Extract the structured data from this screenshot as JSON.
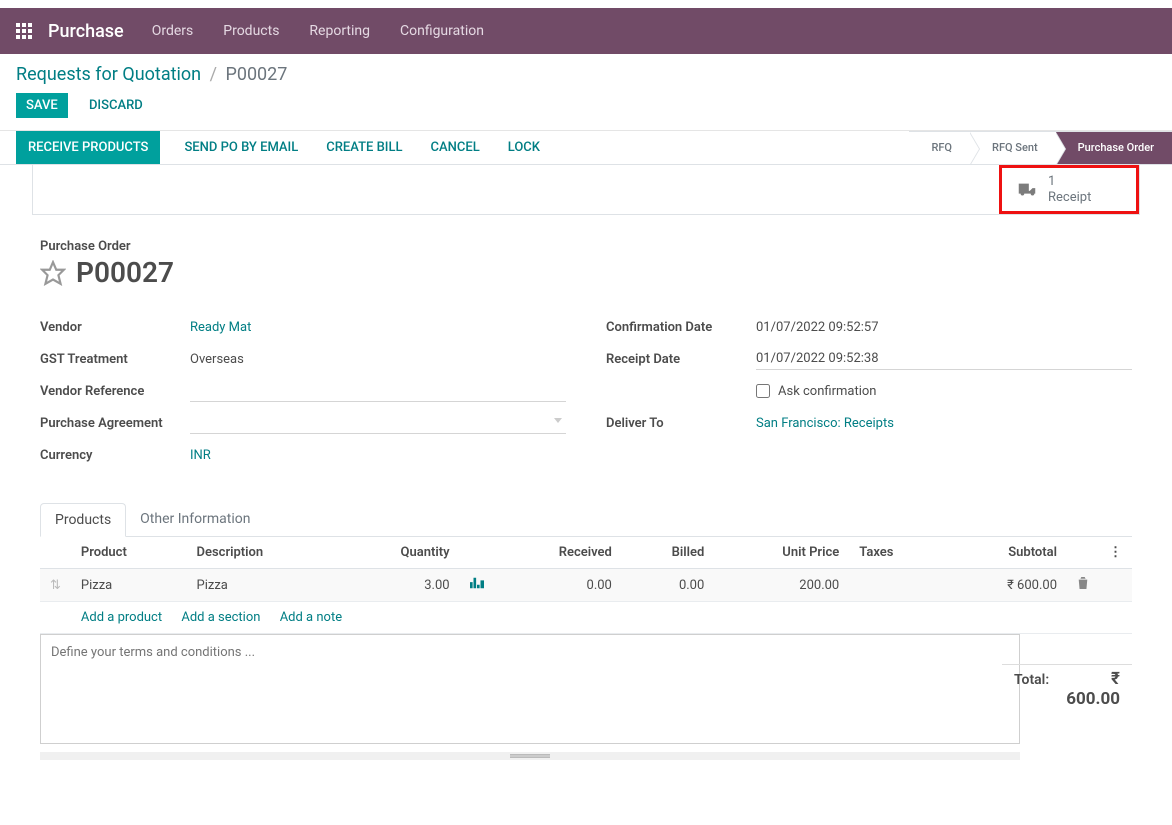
{
  "nav": {
    "app": "Purchase",
    "items": [
      "Orders",
      "Products",
      "Reporting",
      "Configuration"
    ]
  },
  "breadcrumb": {
    "root": "Requests for Quotation",
    "current": "P00027"
  },
  "buttons": {
    "save": "Save",
    "discard": "Discard",
    "receive": "Receive Products",
    "send_po": "Send PO by Email",
    "create_bill": "Create Bill",
    "cancel": "Cancel",
    "lock": "Lock"
  },
  "status": {
    "rfq": "RFQ",
    "rfq_sent": "RFQ Sent",
    "po": "Purchase Order"
  },
  "stat": {
    "count": "1",
    "label": "Receipt"
  },
  "title": {
    "label": "Purchase Order",
    "name": "P00027"
  },
  "fields": {
    "vendor_label": "Vendor",
    "vendor_value": "Ready Mat",
    "gst_label": "GST Treatment",
    "gst_value": "Overseas",
    "vref_label": "Vendor Reference",
    "vref_value": "",
    "pa_label": "Purchase Agreement",
    "pa_value": "",
    "currency_label": "Currency",
    "currency_value": "INR",
    "confirm_label": "Confirmation Date",
    "confirm_value": "01/07/2022 09:52:57",
    "receipt_label": "Receipt Date",
    "receipt_value": "01/07/2022 09:52:38",
    "ask_conf": "Ask confirmation",
    "deliver_label": "Deliver To",
    "deliver_value": "San Francisco: Receipts"
  },
  "tabs": {
    "products": "Products",
    "other": "Other Information"
  },
  "table": {
    "headers": {
      "product": "Product",
      "description": "Description",
      "quantity": "Quantity",
      "received": "Received",
      "billed": "Billed",
      "unit_price": "Unit Price",
      "taxes": "Taxes",
      "subtotal": "Subtotal"
    },
    "row": {
      "product": "Pizza",
      "description": "Pizza",
      "quantity": "3.00",
      "received": "0.00",
      "billed": "0.00",
      "unit_price": "200.00",
      "taxes": "",
      "subtotal": "₹ 600.00"
    },
    "links": {
      "add_product": "Add a product",
      "add_section": "Add a section",
      "add_note": "Add a note"
    }
  },
  "terms_placeholder": "Define your terms and conditions ...",
  "totals": {
    "label": "Total:",
    "amount": "₹ 600.00"
  }
}
